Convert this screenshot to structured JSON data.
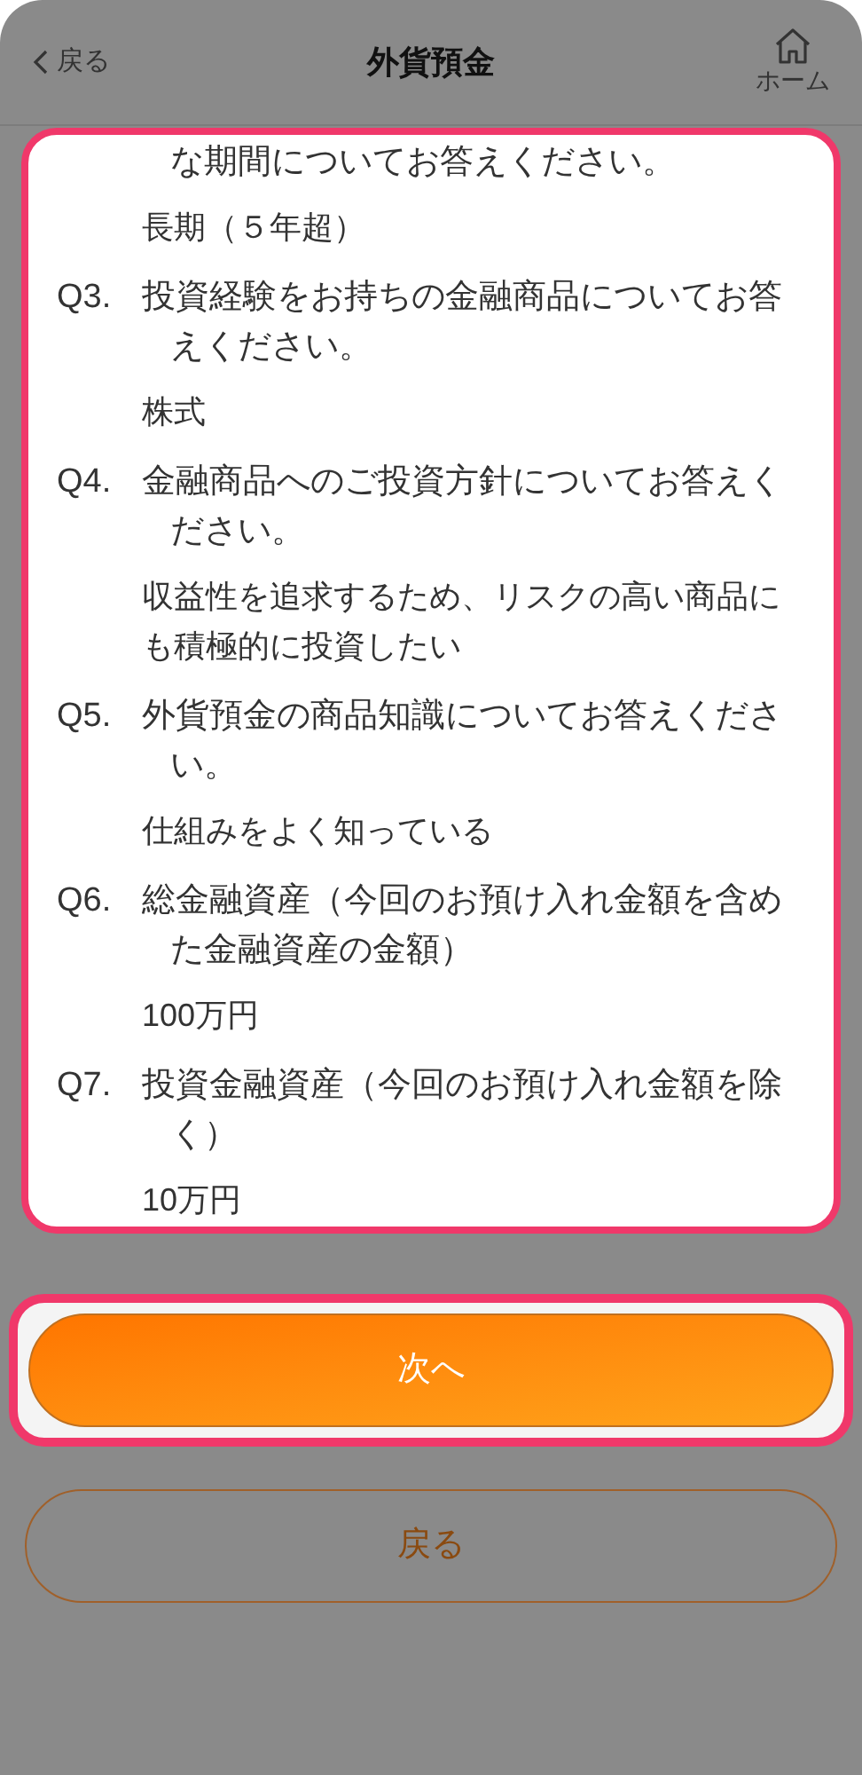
{
  "header": {
    "back": "戻る",
    "title": "外貨預金",
    "home": "ホーム"
  },
  "questions": [
    {
      "question": "な期間についてお答えください。",
      "answer": "長期（５年超）"
    },
    {
      "number": "Q3.",
      "question": "投資経験をお持ちの金融商品についてお答えください。",
      "answer": "株式"
    },
    {
      "number": "Q4.",
      "question": "金融商品へのご投資方針についてお答えください。",
      "answer": "収益性を追求するため、リスクの高い商品にも積極的に投資したい"
    },
    {
      "number": "Q5.",
      "question": "外貨預金の商品知識についてお答えください。",
      "answer": "仕組みをよく知っている"
    },
    {
      "number": "Q6.",
      "question": "総金融資産（今回のお預け入れ金額を含めた金融資産の金額）",
      "answer": "100万円"
    },
    {
      "number": "Q7.",
      "question": "投資金融資産（今回のお預け入れ金額を除く）",
      "answer": "10万円"
    }
  ],
  "buttons": {
    "next": "次へ",
    "back": "戻る"
  }
}
